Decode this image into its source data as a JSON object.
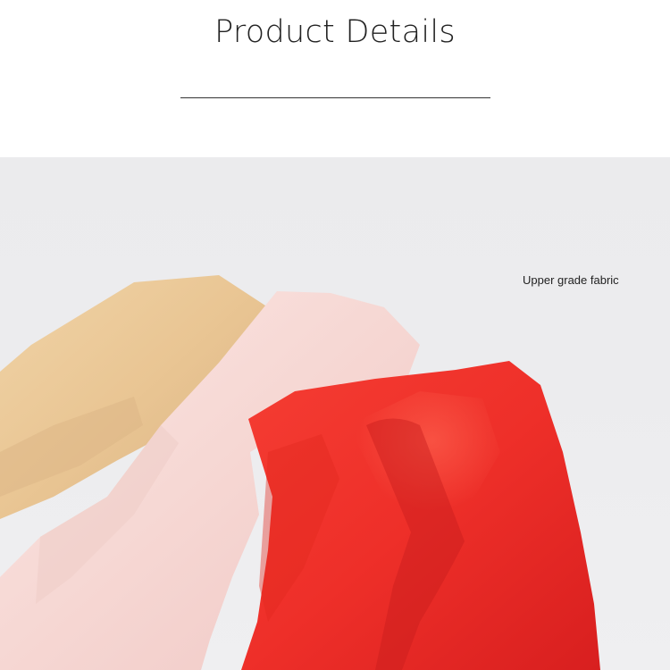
{
  "header": {
    "title": "Product Details"
  },
  "photo": {
    "caption": "Upper grade fabric",
    "fabric_colors": {
      "beige": "#ecc99a",
      "pink": "#f8dcda",
      "red": "#f0302a"
    },
    "background": "#ececee"
  }
}
